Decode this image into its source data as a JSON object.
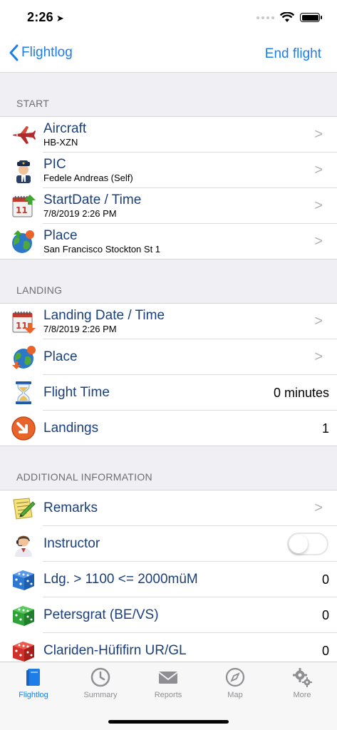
{
  "status": {
    "time": "2:26",
    "location_arrow": "➤"
  },
  "nav": {
    "back_label": "Flightlog",
    "right_label": "End flight"
  },
  "sections": {
    "start": {
      "header": "START",
      "rows": [
        {
          "title": "Aircraft",
          "sub": "HB-XZN",
          "icon": "airplane-icon"
        },
        {
          "title": "PIC",
          "sub": "Fedele Andreas (Self)",
          "icon": "pilot-icon"
        },
        {
          "title": "StartDate / Time",
          "sub": "7/8/2019 2:26 PM",
          "icon": "calendar-up-icon"
        },
        {
          "title": "Place",
          "sub": "San Francisco Stockton St 1",
          "icon": "globe-up-icon"
        }
      ]
    },
    "landing": {
      "header": "LANDING",
      "rows": [
        {
          "title": "Landing Date / Time",
          "sub": "7/8/2019 2:26 PM",
          "icon": "calendar-down-icon"
        },
        {
          "title": "Place",
          "sub": "",
          "icon": "globe-down-icon"
        },
        {
          "title": "Flight Time",
          "value": "0 minutes",
          "icon": "hourglass-icon"
        },
        {
          "title": "Landings",
          "value": "1",
          "icon": "landing-arrow-icon"
        }
      ]
    },
    "additional": {
      "header": "ADDITIONAL INFORMATION",
      "rows": [
        {
          "title": "Remarks",
          "icon": "notepad-pencil-icon"
        },
        {
          "title": "Instructor",
          "icon": "instructor-icon"
        },
        {
          "title": "Ldg. > 1100 <= 2000müM",
          "value": "0",
          "icon": "blue-dice-icon"
        },
        {
          "title": "Petersgrat (BE/VS)",
          "value": "0",
          "icon": "green-dice-icon"
        },
        {
          "title": "Clariden-Hüfifirn UR/GL",
          "value": "0",
          "icon": "red-dice-icon"
        }
      ]
    }
  },
  "chevron": ">",
  "tabs": [
    {
      "label": "Flightlog",
      "icon": "book-icon",
      "active": true
    },
    {
      "label": "Summary",
      "icon": "clock-icon"
    },
    {
      "label": "Reports",
      "icon": "envelope-icon"
    },
    {
      "label": "Map",
      "icon": "compass-icon"
    },
    {
      "label": "More",
      "icon": "gears-icon"
    }
  ],
  "colors": {
    "accent": "#1e7ee8",
    "row_title": "#1b3f7a",
    "grouped_bg": "#efeff4"
  }
}
